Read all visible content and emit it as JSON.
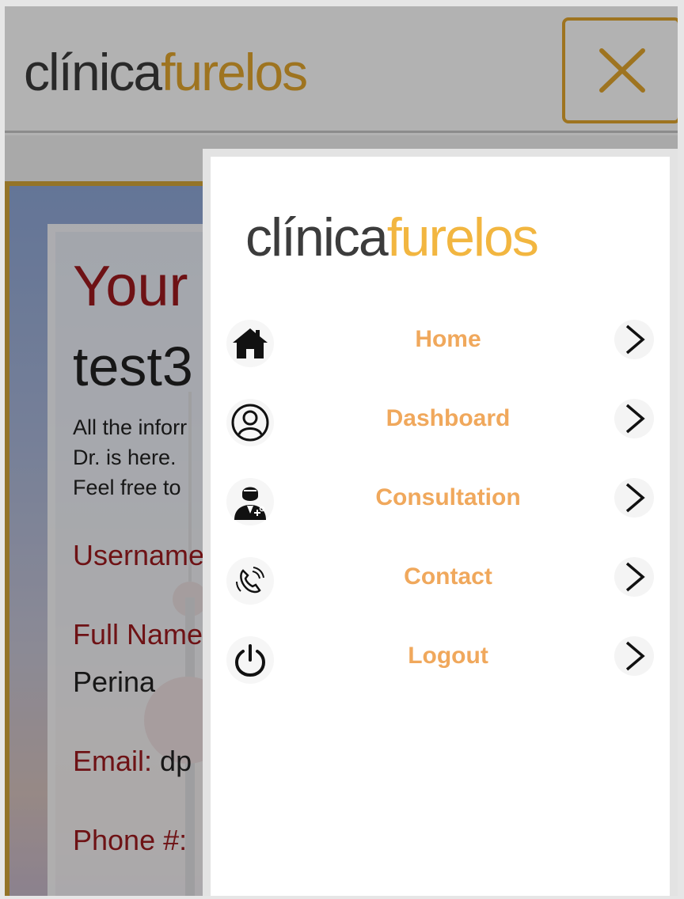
{
  "brand": {
    "part1": "clínica",
    "part2": "furelos"
  },
  "background": {
    "title": "Your",
    "username_partial": "test3",
    "intro_lines": [
      "All the inforr",
      "Dr. is here.",
      "Feel free to"
    ],
    "fields": {
      "username_label": "Username",
      "fullname_label": "Full Name",
      "fullname_value": "Perina",
      "email_label": "Email:",
      "email_value": "dp",
      "phone_label": "Phone #:"
    }
  },
  "menu": {
    "items": [
      {
        "label": "Home",
        "icon": "home-icon"
      },
      {
        "label": "Dashboard",
        "icon": "user-circle-icon"
      },
      {
        "label": "Consultation",
        "icon": "doctor-icon"
      },
      {
        "label": "Contact",
        "icon": "phone-icon"
      },
      {
        "label": "Logout",
        "icon": "power-icon"
      }
    ]
  },
  "colors": {
    "brand_gold": "#e3a72f",
    "menu_label": "#f0a85c",
    "title_red": "#9e1b1f"
  }
}
